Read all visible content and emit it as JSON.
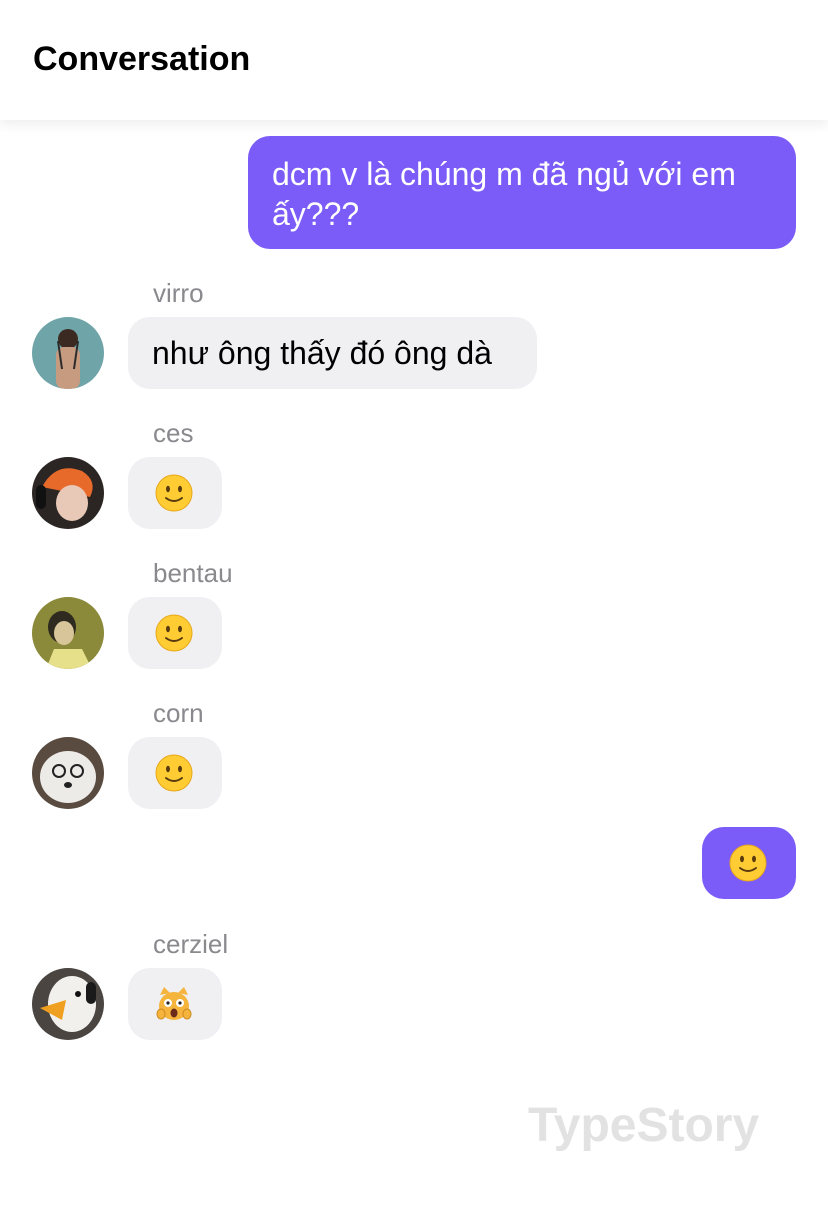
{
  "header": {
    "title": "Conversation"
  },
  "messages": [
    {
      "direction": "out",
      "text": "dcm v là chúng m đã ngủ với em ấy???"
    },
    {
      "direction": "in",
      "sender": "virro",
      "text": "như ông thấy đó ông dà"
    },
    {
      "direction": "in",
      "sender": "ces",
      "emoji": "slightly-smiling-face"
    },
    {
      "direction": "in",
      "sender": "bentau",
      "emoji": "slightly-smiling-face"
    },
    {
      "direction": "in",
      "sender": "corn",
      "emoji": "slightly-smiling-face"
    },
    {
      "direction": "out",
      "emoji": "slightly-smiling-face"
    },
    {
      "direction": "in",
      "sender": "cerziel",
      "emoji": "weary-cat-face"
    }
  ],
  "watermark": "TypeStory",
  "colors": {
    "outgoing_bubble": "#7b5cf8",
    "incoming_bubble": "#f0f0f3",
    "sender_name": "#8a8a8e",
    "watermark": "#e2e2e2"
  }
}
